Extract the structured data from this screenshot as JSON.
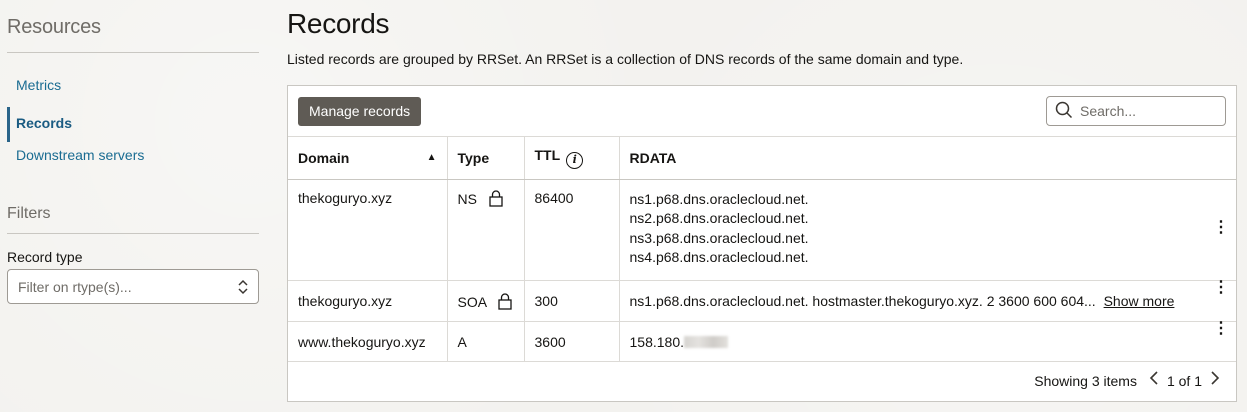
{
  "sidebar": {
    "resources_heading": "Resources",
    "nav": [
      {
        "label": "Metrics",
        "active": false
      },
      {
        "label": "Records",
        "active": true
      },
      {
        "label": "Downstream servers",
        "active": false
      }
    ],
    "filters_heading": "Filters",
    "record_type_label": "Record type",
    "record_type_placeholder": "Filter on rtype(s)..."
  },
  "main": {
    "title": "Records",
    "description": "Listed records are grouped by RRSet. An RRSet is a collection of DNS records of the same domain and type.",
    "manage_button": "Manage records",
    "search_placeholder": "Search...",
    "columns": {
      "domain": "Domain",
      "type": "Type",
      "ttl": "TTL",
      "rdata": "RDATA"
    },
    "rows": [
      {
        "domain": "thekoguryo.xyz",
        "type": "NS",
        "locked": true,
        "ttl": "86400",
        "rdata": [
          "ns1.p68.dns.oraclecloud.net.",
          "ns2.p68.dns.oraclecloud.net.",
          "ns3.p68.dns.oraclecloud.net.",
          "ns4.p68.dns.oraclecloud.net."
        ]
      },
      {
        "domain": "thekoguryo.xyz",
        "type": "SOA",
        "locked": true,
        "ttl": "300",
        "rdata_text": "ns1.p68.dns.oraclecloud.net. hostmaster.thekoguryo.xyz. 2 3600 600 604...",
        "show_more": "Show more"
      },
      {
        "domain": "www.thekoguryo.xyz",
        "type": "A",
        "locked": false,
        "ttl": "3600",
        "rdata_text": "158.180."
      }
    ],
    "footer": {
      "showing": "Showing 3 items",
      "page": "1 of 1"
    }
  },
  "colors": {
    "link": "#1a6c92",
    "active_indicator": "#2a6489",
    "button_bg": "#5f5b55",
    "background": "#f3f2ef"
  }
}
